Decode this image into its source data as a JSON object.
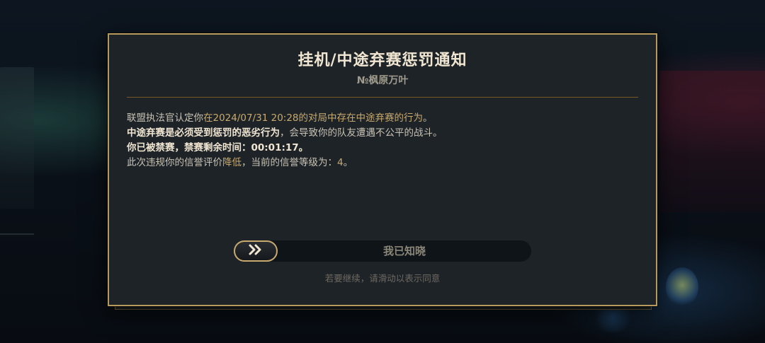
{
  "dialog": {
    "title": "挂机/中途弃赛惩罚通知",
    "subtitle": "№枫原万叶",
    "lines": {
      "l1_a": "联盟执法官认定你",
      "l1_b": "在2024/07/31 20:28的对局中存在中途弃赛的行为",
      "l1_c": "。",
      "l2_a": "中途弃赛是必须受到惩罚的恶劣行为",
      "l2_b": "，会导致你的队友遭遇不公平的战斗。",
      "l3": "你已被禁赛，禁赛剩余时间：00:01:17。",
      "l4_a": "此次违规你的信誉评价",
      "l4_b": "降低",
      "l4_c": "，当前的信誉等级为：",
      "l4_d": "4",
      "l4_e": "。"
    },
    "slider": {
      "label": "我已知晓",
      "knob_icon": "double-chevron-right-icon"
    },
    "hint": "若要继续，请滑动以表示同意"
  },
  "colors": {
    "accent_gold": "#c8aa6e",
    "border_gold": "#b59a5b",
    "panel_bg": "#1e2328",
    "title_text": "#f0e6d2"
  }
}
